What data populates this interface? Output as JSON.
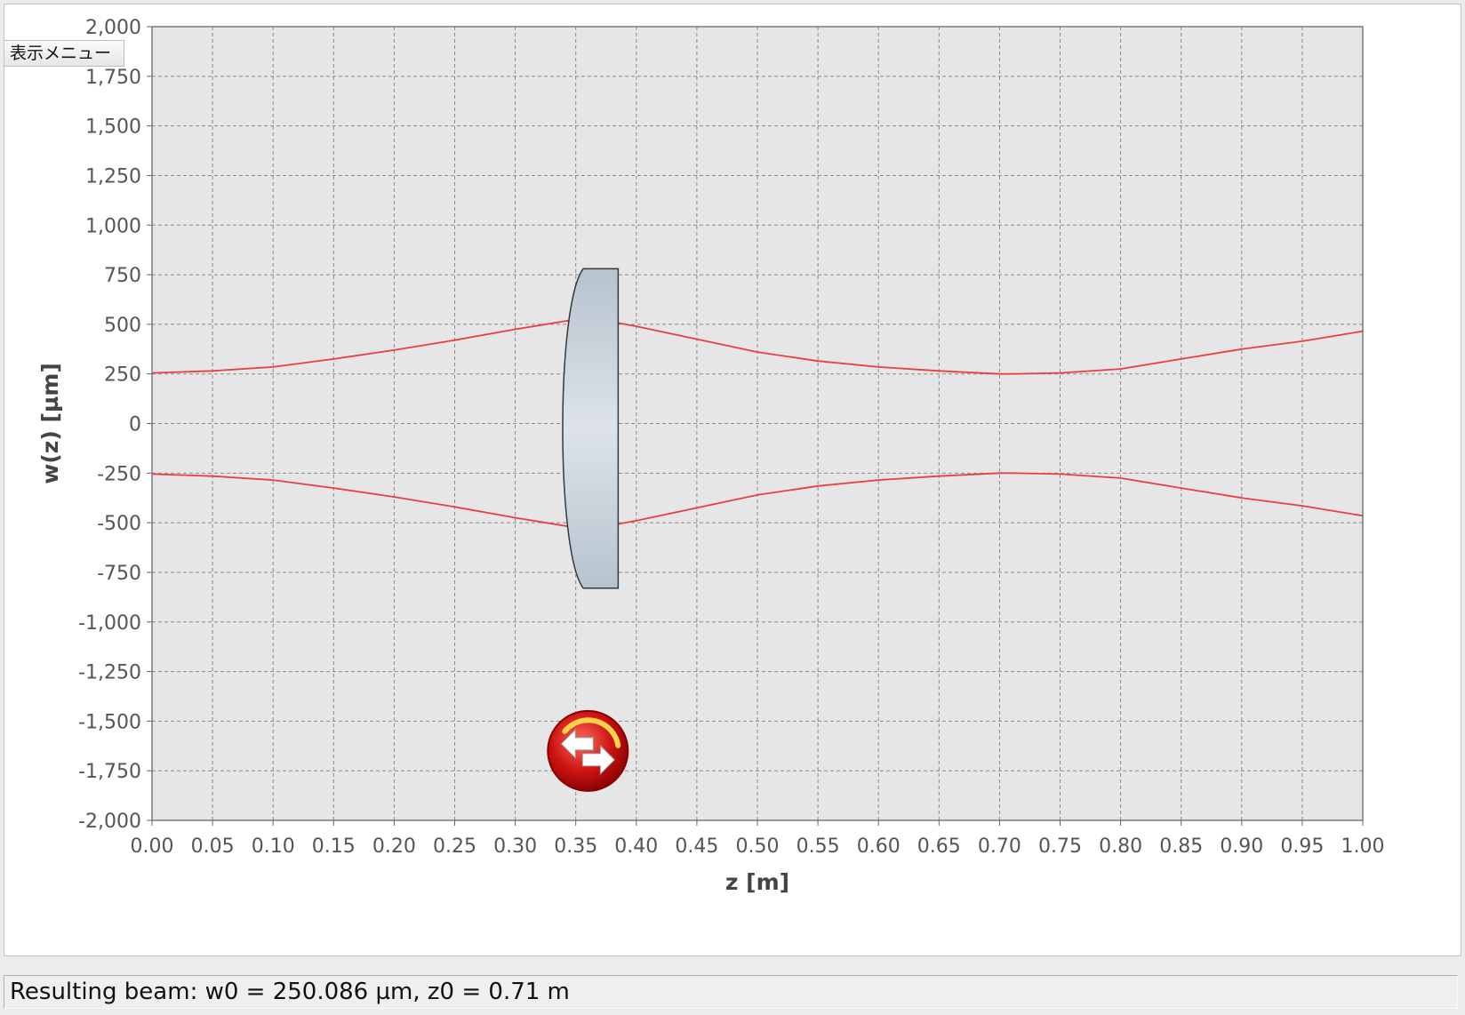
{
  "menu": {
    "label": "表示メニュー"
  },
  "status": {
    "text": "Resulting beam: w0 = 250.086 µm, z0 = 0.71 m"
  },
  "colors": {
    "plot_background": "#e6e6e6",
    "grid": "#8a8a8a",
    "beam": "#e84040",
    "lens_fill": "#c5cfd8",
    "lens_stroke": "#333a40",
    "button_red": "#cc1111"
  },
  "icons": {
    "swap_button": "swap-arrows-icon"
  },
  "chart_data": {
    "type": "line",
    "xlabel": "z [m]",
    "ylabel": "w(z) [µm]",
    "xlim": [
      0,
      1.0
    ],
    "ylim": [
      -2000,
      2000
    ],
    "grid": true,
    "x_ticks": [
      0,
      0.05,
      0.1,
      0.15,
      0.2,
      0.25,
      0.3,
      0.35,
      0.4,
      0.45,
      0.5,
      0.55,
      0.6,
      0.65,
      0.7,
      0.75,
      0.8,
      0.85,
      0.9,
      0.95,
      1.0
    ],
    "x_tick_labels": [
      "0.00",
      "0.05",
      "0.10",
      "0.15",
      "0.20",
      "0.25",
      "0.30",
      "0.35",
      "0.40",
      "0.45",
      "0.50",
      "0.55",
      "0.60",
      "0.65",
      "0.70",
      "0.75",
      "0.80",
      "0.85",
      "0.90",
      "0.95",
      "1.00"
    ],
    "y_ticks": [
      2000,
      1750,
      1500,
      1250,
      1000,
      750,
      500,
      250,
      0,
      -250,
      -500,
      -750,
      -1000,
      -1250,
      -1500,
      -1750,
      -2000
    ],
    "y_tick_labels": [
      "2,000",
      "1,750",
      "1,500",
      "1,250",
      "1,000",
      "750",
      "500",
      "250",
      "0",
      "-250",
      "-500",
      "-750",
      "-1,000",
      "-1,250",
      "-1,500",
      "-1,750",
      "-2,000"
    ],
    "series": [
      {
        "x": [
          0.0,
          0.05,
          0.1,
          0.15,
          0.2,
          0.25,
          0.3,
          0.33,
          0.36,
          0.4,
          0.45,
          0.5,
          0.55,
          0.6,
          0.65,
          0.7,
          0.71,
          0.75,
          0.8,
          0.85,
          0.9,
          0.95,
          1.0
        ],
        "values": [
          255,
          265,
          285,
          325,
          370,
          420,
          475,
          505,
          535,
          490,
          425,
          360,
          315,
          285,
          265,
          250,
          250,
          255,
          275,
          325,
          375,
          415,
          465
        ]
      },
      {
        "x": [
          0.0,
          0.05,
          0.1,
          0.15,
          0.2,
          0.25,
          0.3,
          0.33,
          0.36,
          0.4,
          0.45,
          0.5,
          0.55,
          0.6,
          0.65,
          0.7,
          0.71,
          0.75,
          0.8,
          0.85,
          0.9,
          0.95,
          1.0
        ],
        "values": [
          -255,
          -265,
          -285,
          -325,
          -370,
          -420,
          -475,
          -505,
          -535,
          -490,
          -425,
          -360,
          -315,
          -285,
          -265,
          -250,
          -250,
          -255,
          -275,
          -325,
          -375,
          -415,
          -465
        ]
      }
    ],
    "lens": {
      "z_start": 0.34,
      "z_end": 0.385,
      "aperture_top": 780,
      "aperture_bottom": -830
    },
    "swap_button_position": {
      "z": 0.36,
      "w": -1650
    }
  }
}
